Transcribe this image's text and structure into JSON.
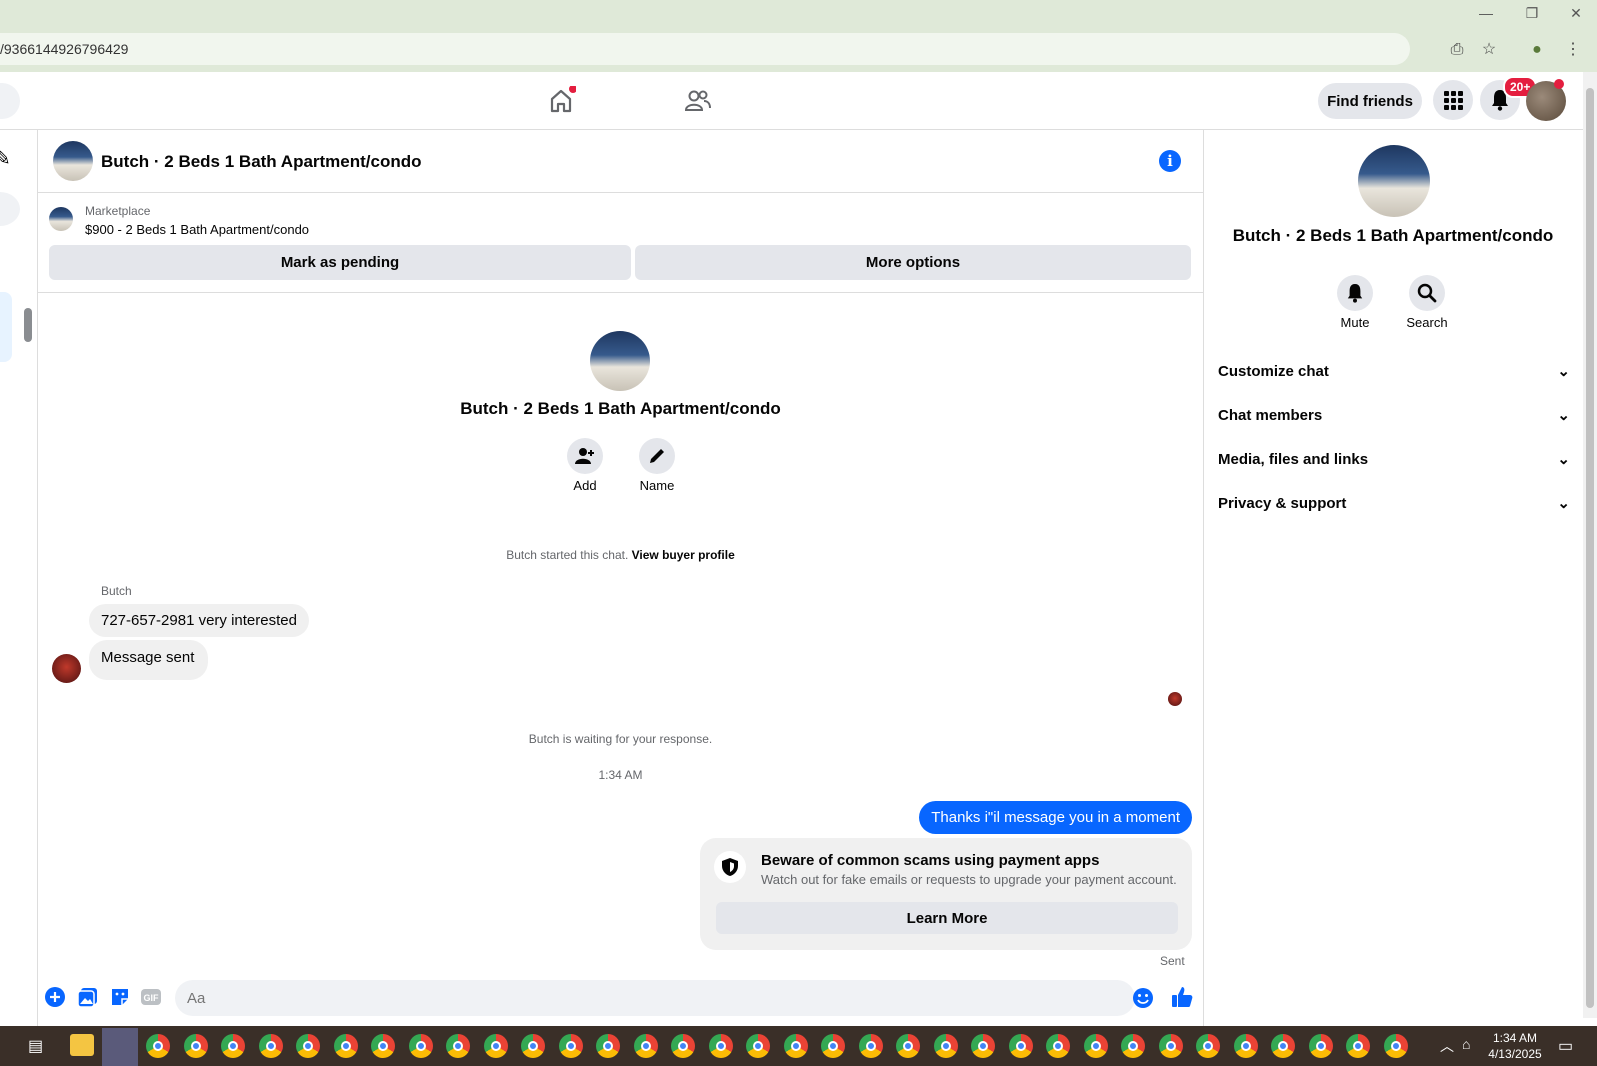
{
  "browser": {
    "url": "/9366144926796429",
    "window_controls": [
      "minimize",
      "restore",
      "close"
    ]
  },
  "topbar": {
    "find_friends": "Find friends",
    "notification_badge": "20+"
  },
  "chat": {
    "title": "Butch · 2 Beds 1 Bath Apartment/condo",
    "marketplace_label": "Marketplace",
    "listing": "$900 - 2 Beds 1 Bath Apartment/condo",
    "mark_pending": "Mark as pending",
    "more_options": "More options",
    "profile_name": "Butch · 2 Beds 1 Bath Apartment/condo",
    "add_label": "Add",
    "name_label": "Name",
    "started_text": "Butch started this chat.",
    "view_buyer": "View buyer profile",
    "sender": "Butch",
    "messages_in": [
      "727-657-2981 very interested",
      "Message sent"
    ],
    "waiting": "Butch is waiting for your response.",
    "timestamp": "1:34 AM",
    "message_out": "Thanks i\"il message you in a moment",
    "scam_title": "Beware of common scams using payment apps",
    "scam_sub": "Watch out for fake emails or requests to upgrade your payment account.",
    "learn_more": "Learn More",
    "sent": "Sent",
    "composer_placeholder": "Aa"
  },
  "panel": {
    "name": "Butch · 2 Beds 1 Bath Apartment/condo",
    "mute": "Mute",
    "search": "Search",
    "sections": [
      "Customize chat",
      "Chat members",
      "Media, files and links",
      "Privacy & support"
    ]
  },
  "taskbar": {
    "time": "1:34 AM",
    "date": "4/13/2025"
  },
  "colors": {
    "accent": "#0866ff",
    "badge": "#e41e3f"
  }
}
